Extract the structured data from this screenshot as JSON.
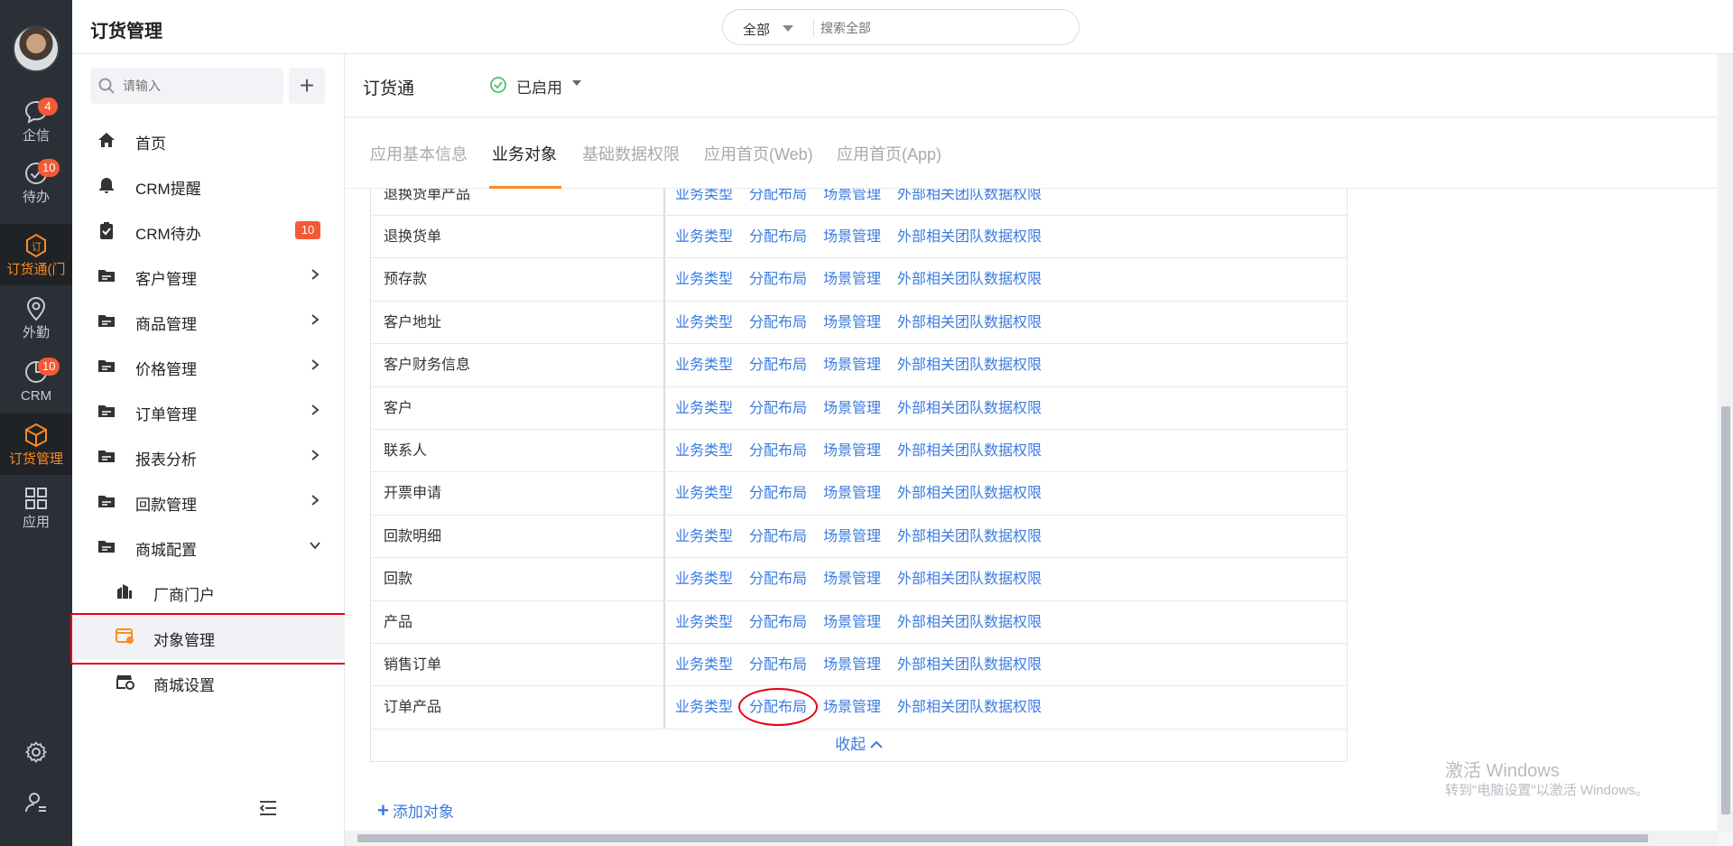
{
  "rail": {
    "items": [
      {
        "label": "企信",
        "badge": "4"
      },
      {
        "label": "待办",
        "badge": "10"
      },
      {
        "label": "订货通(门",
        "badge": ""
      },
      {
        "label": "外勤",
        "badge": ""
      },
      {
        "label": "CRM",
        "badge": "10"
      },
      {
        "label": "订货管理",
        "badge": ""
      },
      {
        "label": "应用",
        "badge": ""
      }
    ]
  },
  "topbar": {
    "title": "订货管理",
    "search_scope": "全部",
    "search_placeholder": "搜索全部"
  },
  "sidenav": {
    "search_placeholder": "请输入",
    "items": [
      {
        "label": "首页"
      },
      {
        "label": "CRM提醒"
      },
      {
        "label": "CRM待办",
        "badge": "10"
      },
      {
        "label": "客户管理"
      },
      {
        "label": "商品管理"
      },
      {
        "label": "价格管理"
      },
      {
        "label": "订单管理"
      },
      {
        "label": "报表分析"
      },
      {
        "label": "回款管理"
      },
      {
        "label": "商城配置"
      },
      {
        "label": "厂商门户"
      },
      {
        "label": "对象管理"
      },
      {
        "label": "商城设置"
      }
    ]
  },
  "app": {
    "name": "订货通",
    "status": "已启用"
  },
  "tabs": [
    "应用基本信息",
    "业务对象",
    "基础数据权限",
    "应用首页(Web)",
    "应用首页(App)"
  ],
  "table": {
    "link_labels": [
      "业务类型",
      "分配布局",
      "场景管理",
      "外部相关团队数据权限"
    ],
    "rows": [
      "退换货单产品",
      "退换货单",
      "预存款",
      "客户地址",
      "客户财务信息",
      "客户",
      "联系人",
      "开票申请",
      "回款明细",
      "回款",
      "产品",
      "销售订单",
      "订单产品"
    ],
    "collapse_label": "收起",
    "add_label": "添加对象"
  },
  "watermark": {
    "title": "激活 Windows",
    "subtitle": "转到\"电脑设置\"以激活 Windows。"
  },
  "colors": {
    "accent": "#ff8a1f",
    "link": "#3a7be0",
    "badge": "#f35a37",
    "highlight": "#e60012"
  }
}
